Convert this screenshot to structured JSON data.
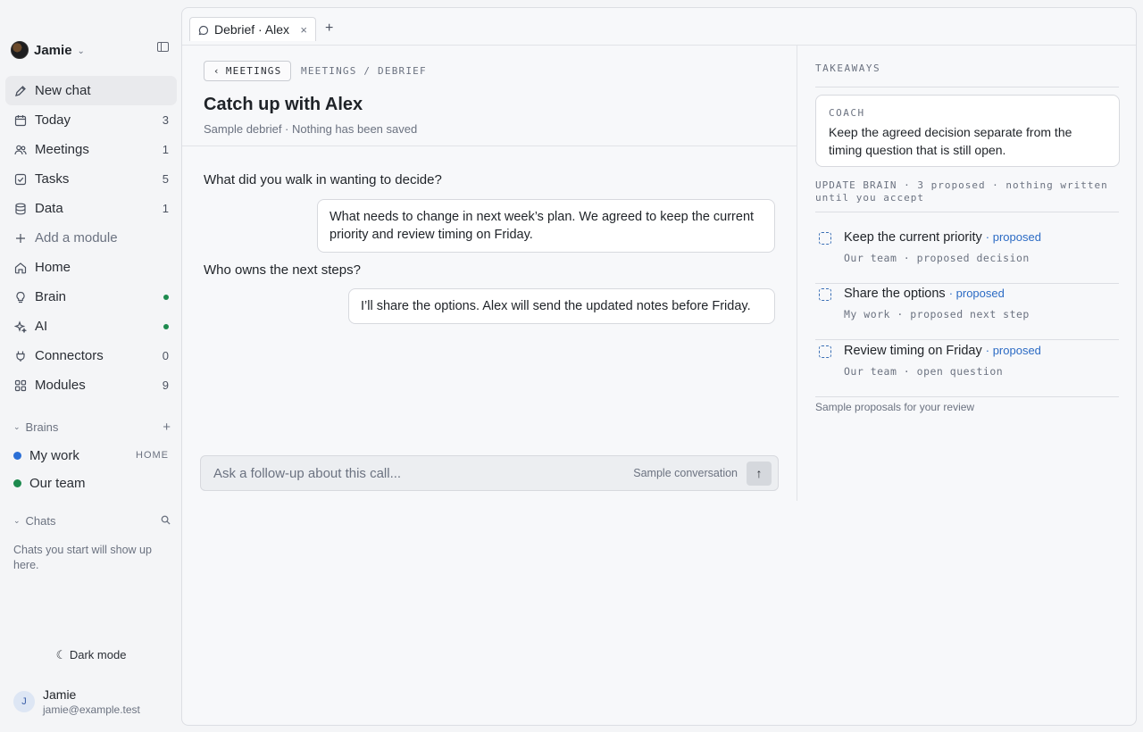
{
  "workspace": {
    "name": "Jamie"
  },
  "nav": {
    "items": [
      {
        "id": "new-chat",
        "label": "New chat",
        "icon": "pencil-icon",
        "count": ""
      },
      {
        "id": "today",
        "label": "Today",
        "icon": "calendar-icon",
        "count": "3"
      },
      {
        "id": "meetings",
        "label": "Meetings",
        "icon": "people-icon",
        "count": "1"
      },
      {
        "id": "tasks",
        "label": "Tasks",
        "icon": "checkbox-icon",
        "count": "5"
      },
      {
        "id": "data",
        "label": "Data",
        "icon": "database-icon",
        "count": "1"
      },
      {
        "id": "add-module",
        "label": "Add a module",
        "icon": "plus-icon",
        "count": ""
      },
      {
        "id": "home",
        "label": "Home",
        "icon": "home-icon",
        "count": ""
      },
      {
        "id": "brain",
        "label": "Brain",
        "icon": "lightbulb-icon",
        "status": "green-dot"
      },
      {
        "id": "ai",
        "label": "AI",
        "icon": "sparkle-icon",
        "status": "green-dot"
      },
      {
        "id": "connectors",
        "label": "Connectors",
        "icon": "plug-icon",
        "count": "0"
      },
      {
        "id": "modules",
        "label": "Modules",
        "icon": "grid-icon",
        "count": "9"
      }
    ]
  },
  "brains": {
    "label": "Brains",
    "items": [
      {
        "label": "My work",
        "color": "#2b6fd6",
        "tag": "HOME"
      },
      {
        "label": "Our team",
        "color": "#1d8a4e",
        "tag": ""
      }
    ]
  },
  "chats": {
    "label": "Chats",
    "empty_text": "Chats you start will show up here."
  },
  "dark_mode_label": "Dark mode",
  "user": {
    "initial": "J",
    "name": "Jamie",
    "email": "jamie@example.test"
  },
  "tabs": [
    {
      "label": "Debrief · Alex"
    }
  ],
  "header": {
    "back_label": "MEETINGS",
    "breadcrumb": "MEETINGS / DEBRIEF",
    "title": "Catch up with Alex",
    "subtitle": "Sample debrief · Nothing has been saved"
  },
  "conversation": [
    {
      "question": "What did you walk in wanting to decide?",
      "answer": "What needs to change in next week’s plan. We agreed to keep the current priority and review timing on Friday."
    },
    {
      "question": "Who owns the next steps?",
      "answer": "I’ll share the options. Alex will send the updated notes before Friday."
    }
  ],
  "composer": {
    "placeholder": "Ask a follow-up about this call...",
    "note": "Sample conversation"
  },
  "takeaways": {
    "title": "TAKEAWAYS",
    "coach": {
      "label": "COACH",
      "text": "Keep the agreed decision separate from the timing question that is still open."
    },
    "update_heading": "UPDATE BRAIN · 3 proposed · nothing written until you accept",
    "proposals": [
      {
        "title": "Keep the current priority",
        "status": "· proposed",
        "meta": "Our team · proposed decision"
      },
      {
        "title": "Share the options",
        "status": "· proposed",
        "meta": "My work · proposed next step"
      },
      {
        "title": "Review timing on Friday",
        "status": "· proposed",
        "meta": "Our team · open question"
      }
    ],
    "footnote": "Sample proposals for your review"
  }
}
